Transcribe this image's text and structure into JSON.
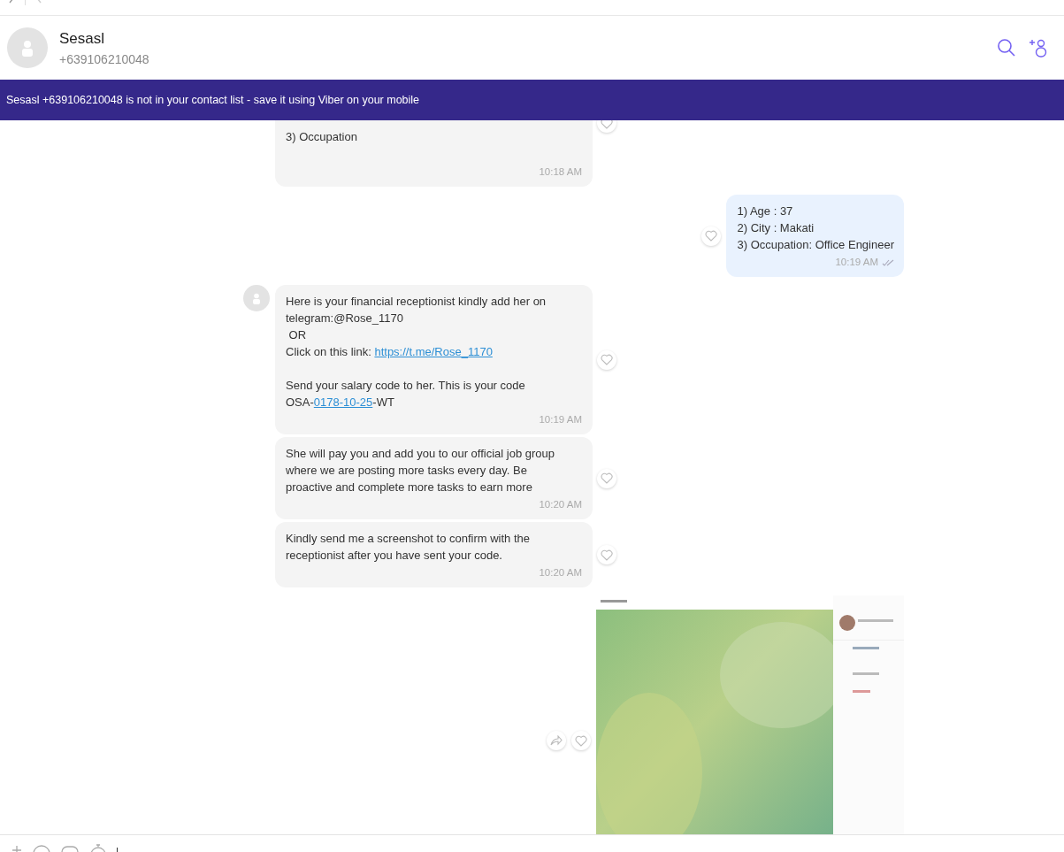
{
  "header": {
    "name": "Sesasl",
    "phone": "+639106210048"
  },
  "banner": "Sesasl +639106210048 is not in your contact list - save it using Viber on your mobile",
  "messages": [
    {
      "kind": "incoming",
      "show_avatar": false,
      "cut_top": true,
      "paragraphs": [
        [
          [
            {
              "text": "3) Occupation",
              "link": false
            }
          ]
        ]
      ],
      "time": "10:18 AM",
      "read": false
    },
    {
      "kind": "outgoing",
      "show_avatar": false,
      "cut_top": false,
      "paragraphs": [
        [
          [
            {
              "text": "1) Age : 37",
              "link": false
            }
          ],
          [
            {
              "text": "2) City : Makati",
              "link": false
            }
          ],
          [
            {
              "text": "3) Occupation: Office Engineer",
              "link": false
            }
          ]
        ]
      ],
      "time": "10:19 AM",
      "read": true
    },
    {
      "kind": "incoming",
      "show_avatar": true,
      "cut_top": false,
      "paragraphs": [
        [
          [
            {
              "text": "Here is your financial receptionist kindly add her on",
              "link": false
            }
          ],
          [
            {
              "text": "telegram:@Rose_1170",
              "link": false
            }
          ],
          [
            {
              "text": " OR",
              "link": false
            }
          ],
          [
            {
              "text": "Click on this link: ",
              "link": false
            },
            {
              "text": "https://t.me/Rose_1170",
              "link": true
            }
          ]
        ],
        [
          [
            {
              "text": "Send your salary code to her. This is your code",
              "link": false
            }
          ],
          [
            {
              "text": "OSA-",
              "link": false
            },
            {
              "text": "0178-10-25",
              "link": true
            },
            {
              "text": "-WT",
              "link": false
            }
          ]
        ]
      ],
      "time": "10:19 AM",
      "read": false
    },
    {
      "kind": "incoming",
      "show_avatar": false,
      "cut_top": false,
      "paragraphs": [
        [
          [
            {
              "text": "She will pay you and add you to our official job group",
              "link": false
            }
          ],
          [
            {
              "text": "where we are posting more tasks every day. Be",
              "link": false
            }
          ],
          [
            {
              "text": "proactive and complete more tasks to earn more",
              "link": false
            }
          ]
        ]
      ],
      "time": "10:20 AM",
      "read": false
    },
    {
      "kind": "incoming",
      "show_avatar": false,
      "cut_top": false,
      "paragraphs": [
        [
          [
            {
              "text": "Kindly send me a screenshot to confirm with the",
              "link": false
            }
          ],
          [
            {
              "text": "receptionist after you have sent your code.",
              "link": false
            }
          ]
        ]
      ],
      "time": "10:20 AM",
      "read": false
    },
    {
      "kind": "picture"
    }
  ]
}
